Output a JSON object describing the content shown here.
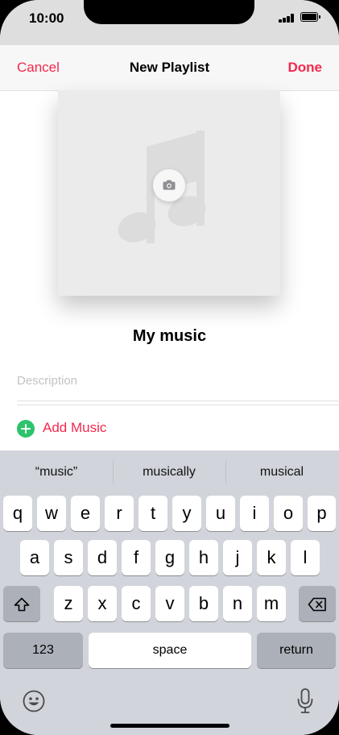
{
  "status": {
    "time": "10:00"
  },
  "nav": {
    "cancel": "Cancel",
    "title": "New Playlist",
    "done": "Done"
  },
  "artwork": {
    "icon": "music-note-icon",
    "camera_icon": "camera-icon"
  },
  "playlist": {
    "name": "My music",
    "description_placeholder": "Description",
    "description_value": ""
  },
  "add_music": {
    "label": "Add Music",
    "icon": "plus-circle-icon"
  },
  "keyboard": {
    "suggestions": [
      "“music”",
      "musically",
      "musical"
    ],
    "row1": [
      "q",
      "w",
      "e",
      "r",
      "t",
      "y",
      "u",
      "i",
      "o",
      "p"
    ],
    "row2": [
      "a",
      "s",
      "d",
      "f",
      "g",
      "h",
      "j",
      "k",
      "l"
    ],
    "row3": [
      "z",
      "x",
      "c",
      "v",
      "b",
      "n",
      "m"
    ],
    "numbers_key": "123",
    "space_key": "space",
    "return_key": "return",
    "shift_icon": "shift-icon",
    "delete_icon": "delete-icon",
    "emoji_icon": "emoji-icon",
    "mic_icon": "microphone-icon"
  },
  "colors": {
    "accent": "#f4284e",
    "add_green": "#2cc36b"
  }
}
